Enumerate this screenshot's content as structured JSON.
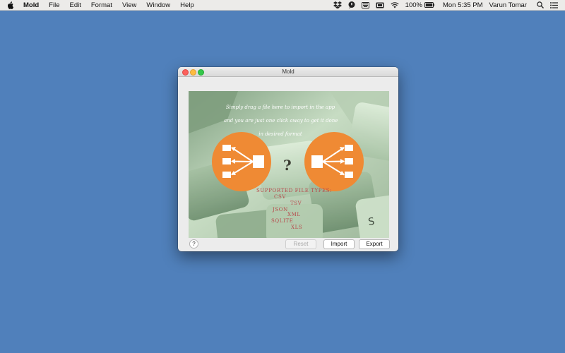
{
  "menubar": {
    "apple_icon": "apple-logo-icon",
    "app_name": "Mold",
    "menus": [
      "File",
      "Edit",
      "Format",
      "View",
      "Window",
      "Help"
    ],
    "status": {
      "battery": "100%",
      "clock": "Mon 5:35 PM",
      "user": "Varun Tomar"
    }
  },
  "window": {
    "title": "Mold",
    "drop_area": {
      "caption_lines": [
        "Simply drag a file here to import in the app",
        "and you are just one click away to get it done",
        "in desired format"
      ],
      "question_mark": "?",
      "supported_label": "SUPPORTED FILE TYPES:",
      "file_types": [
        "CSV",
        "TSV",
        "JSON",
        "XML",
        "SQLITE",
        "XLS"
      ]
    },
    "buttons": {
      "help": "?",
      "reset": "Reset",
      "import": "Import",
      "export": "Export"
    }
  },
  "colors": {
    "desktop": "#5080bb",
    "circle": "#ef8a34",
    "file_types_text": "#b8474a",
    "close": "#fc615d",
    "minimize": "#fdbc40",
    "zoom": "#34c84a"
  }
}
